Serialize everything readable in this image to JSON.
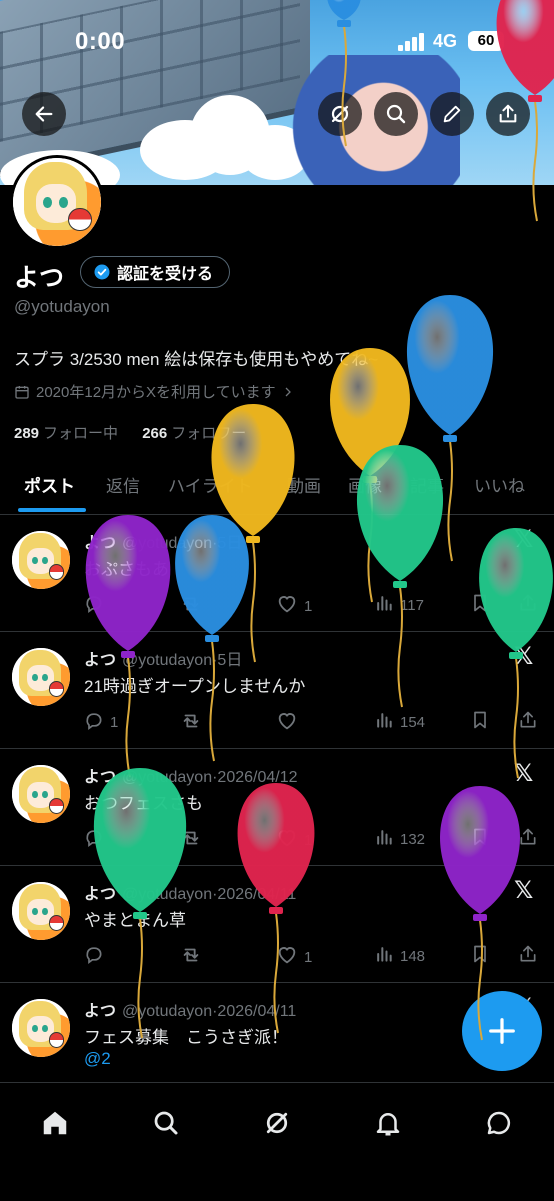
{
  "status_bar": {
    "time": "0:00",
    "network": "4G",
    "battery": "60"
  },
  "header_actions": {
    "back": "arrow-left-icon",
    "grok": "grok-icon",
    "search": "search-icon",
    "edit": "pencil-icon",
    "share": "share-icon"
  },
  "profile": {
    "name": "よつ",
    "verify_button": "認証を受ける",
    "handle": "@yotudayon",
    "bio": "スプラ 3/2530 men 絵は保存も使用もやめてね~",
    "joined": "2020年12月からXを利用しています",
    "following_count": "289",
    "following_label": "フォロー中",
    "followers_count": "266",
    "followers_label": "フォロワー"
  },
  "tabs": [
    {
      "label": "ポスト",
      "active": true
    },
    {
      "label": "返信"
    },
    {
      "label": "ハイライト"
    },
    {
      "label": "動画"
    },
    {
      "label": "画像"
    },
    {
      "label": "記事"
    },
    {
      "label": "いいね"
    }
  ],
  "posts": [
    {
      "name": "よつ",
      "handle": "@yotudayon",
      "date": "5日",
      "text": "おぷさもあ",
      "mention": "",
      "reply": "",
      "retweet": "",
      "like": "1",
      "views": "117"
    },
    {
      "name": "よつ",
      "handle": "@yotudayon",
      "date": "5日",
      "text": "21時過ぎオープンしませんか",
      "mention": "",
      "reply": "1",
      "retweet": "",
      "like": "",
      "views": "154"
    },
    {
      "name": "よつ",
      "handle": "@yotudayon",
      "date": "2026/04/12",
      "text": "おつフェスさも",
      "mention": "",
      "reply": "",
      "retweet": "",
      "like": "1",
      "views": "132"
    },
    {
      "name": "よつ",
      "handle": "@yotudayon",
      "date": "2026/04/11",
      "text": "やまとまん草",
      "mention": "",
      "reply": "",
      "retweet": "",
      "like": "1",
      "views": "148"
    },
    {
      "name": "よつ",
      "handle": "@yotudayon",
      "date": "2026/04/11",
      "text": "フェス募集　こうさぎ派！",
      "mention": "@2",
      "reply": "",
      "retweet": "",
      "like": "",
      "views": ""
    }
  ],
  "fab": {
    "icon": "plus-icon"
  },
  "bottom_nav": [
    "home-icon",
    "search-icon",
    "grok-icon",
    "bell-icon",
    "messages-icon"
  ],
  "colors": {
    "accent": "#1d9bf0",
    "background": "#000000",
    "text": "#e7e9ea",
    "muted": "#71767b"
  },
  "balloon_colors": [
    "#8e24c9",
    "#2a8ee0",
    "#f0b81e",
    "#22c78a",
    "#e0244e"
  ]
}
